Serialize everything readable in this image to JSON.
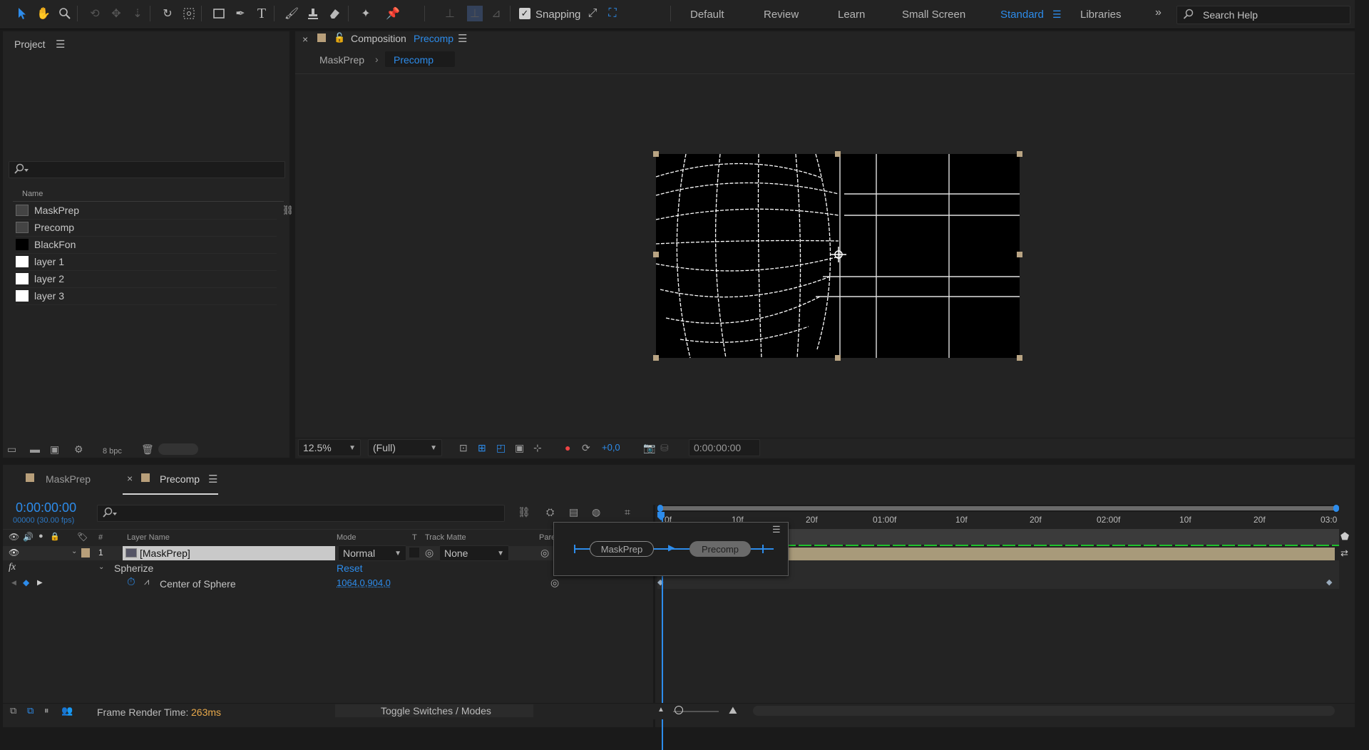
{
  "toolbar": {
    "snapping_label": "Snapping",
    "workspaces": [
      "Default",
      "Review",
      "Learn",
      "Small Screen",
      "Standard",
      "Libraries"
    ],
    "active_workspace": "Standard",
    "search_placeholder": "Search Help"
  },
  "project": {
    "title": "Project",
    "search_placeholder": "",
    "column_name": "Name",
    "items": [
      {
        "name": "MaskPrep",
        "type": "composition"
      },
      {
        "name": "Precomp",
        "type": "composition"
      },
      {
        "name": "BlackFon",
        "type": "solid-black"
      },
      {
        "name": "layer 1",
        "type": "solid-white"
      },
      {
        "name": "layer 2",
        "type": "solid-white"
      },
      {
        "name": "layer 3",
        "type": "solid-white"
      }
    ],
    "bpc": "8 bpc"
  },
  "composition": {
    "tab_prefix": "Composition",
    "tab_name": "Precomp",
    "breadcrumb": [
      "MaskPrep",
      "Precomp"
    ],
    "zoom": "12.5%",
    "resolution": "(Full)",
    "exposure": "+0,0",
    "timecode": "0:00:00:00"
  },
  "timeline": {
    "tabs": [
      "MaskPrep",
      "Precomp"
    ],
    "active_tab": "Precomp",
    "timecode": "0:00:00:00",
    "frame_info": "00000 (30.00 fps)",
    "columns": {
      "layer_name": "Layer Name",
      "mode": "Mode",
      "t": "T",
      "track_matte": "Track Matte",
      "parent": "Pare"
    },
    "layer": {
      "index": "1",
      "name": "[MaskPrep]",
      "mode": "Normal",
      "track_matte": "None"
    },
    "effect": {
      "name": "Spherize",
      "reset": "Reset"
    },
    "property": {
      "name": "Center of Sphere",
      "value": "1064,0,904,0"
    },
    "flow": {
      "from": "MaskPrep",
      "to": "Precomp"
    },
    "ruler_ticks": [
      "0f",
      "10f",
      "20f",
      "01:00f",
      "10f",
      "20f",
      "02:00f",
      "10f",
      "20f",
      "03:0"
    ],
    "render_time_label": "Frame Render Time:",
    "render_time_value": "263ms",
    "toggle_label": "Toggle Switches / Modes"
  },
  "colors": {
    "accent": "#2d8ceb",
    "render_time": "#e8a94a",
    "layer_bar": "#a89a7a",
    "work_area_green": "#1fc12c"
  }
}
